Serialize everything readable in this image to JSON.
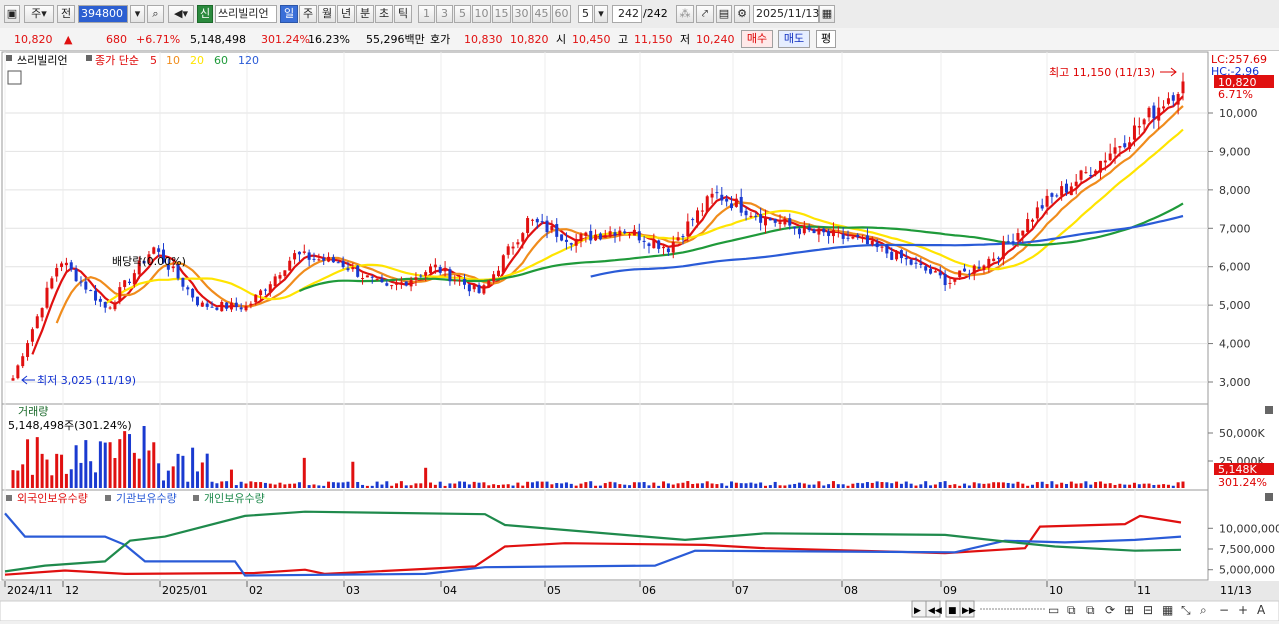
{
  "toolbar": {
    "market": "주",
    "prev": "전",
    "code": "394800",
    "credit_badge": "신",
    "name": "쓰리빌리언",
    "periods": [
      "일",
      "주",
      "월",
      "년",
      "분",
      "초",
      "틱"
    ],
    "active_period": "일",
    "intervals": [
      "1",
      "3",
      "5",
      "10",
      "15",
      "30",
      "45",
      "60"
    ],
    "interval_value": "5",
    "count": "242",
    "count_total": "/242",
    "date": "2025/11/13"
  },
  "info": {
    "price": "10,820",
    "arrow": "▲",
    "change": "680",
    "change_pct": "+6.71%",
    "volume": "5,148,498",
    "volume_ratio": "301.24%",
    "turnover_pct": "16.23%",
    "amount": "55,296백만",
    "ask_label": "호가",
    "ask1": "10,830",
    "ask2": "10,820",
    "open_label": "시",
    "open": "10,450",
    "high_label": "고",
    "high": "11,150",
    "low_label": "저",
    "low": "10,240",
    "buy_label": "매수",
    "sell_label": "매도",
    "eval_label": "평"
  },
  "price_panel": {
    "legend_name": "쓰리빌리언",
    "legend_ma_label": "종가 단순",
    "ma_periods": [
      "5",
      "10",
      "20",
      "60",
      "120"
    ],
    "ma_colors": [
      "#e01010",
      "#f08c1c",
      "#ffe400",
      "#1f9a3a",
      "#2a5bd7"
    ],
    "lc_label": "LC:257.69",
    "hc_label": "HC:-2.96",
    "last_price_tag": "10,820",
    "last_pct_tag": "6.71%",
    "high_annot": "최고 11,150 (11/13)",
    "low_annot": "최저 3,025 (11/19)",
    "dividend_annot": "배당락(0.00%)",
    "y_ticks": [
      "10,000",
      "9,000",
      "8,000",
      "7,000",
      "6,000",
      "5,000",
      "4,000",
      "3,000"
    ]
  },
  "volume_panel": {
    "title": "거래량",
    "value_label": "5,148,498주(301.24%)",
    "y_ticks": [
      "50,000K",
      "25,000K"
    ],
    "last_tag": "5,148K",
    "last_pct": "301.24%"
  },
  "holding_panel": {
    "legend": [
      "외국인보유수량",
      "기관보유수량",
      "개인보유수량"
    ],
    "legend_colors": [
      "#e01010",
      "#2a5bd7",
      "#1f8a4c"
    ],
    "y_ticks": [
      "10,000,000",
      "7,500,000",
      "5,000,000"
    ]
  },
  "x_axis": {
    "labels": [
      "2024/11",
      "12",
      "2025/01",
      "02",
      "03",
      "04",
      "05",
      "06",
      "07",
      "08",
      "09",
      "10",
      "11"
    ],
    "right_label": "11/13"
  },
  "chart_data": {
    "type": "candlestick",
    "symbol": "394800",
    "name": "쓰리빌리언",
    "period": "daily",
    "high": {
      "value": 11150,
      "date": "11/13"
    },
    "low": {
      "value": 3025,
      "date": "11/19"
    },
    "last_close": 10820,
    "ma_periods": [
      5,
      10,
      20,
      60,
      120
    ],
    "approx_close_path": [
      {
        "x": "2024/11",
        "y": 3100
      },
      {
        "x": "12",
        "y": 6200
      },
      {
        "x": "12 mid",
        "y": 4900
      },
      {
        "x": "12 late",
        "y": 6500
      },
      {
        "x": "2025/01",
        "y": 5000
      },
      {
        "x": "01 mid",
        "y": 4950
      },
      {
        "x": "02",
        "y": 6300
      },
      {
        "x": "02 mid",
        "y": 6100
      },
      {
        "x": "03",
        "y": 5400
      },
      {
        "x": "03 mid",
        "y": 6000
      },
      {
        "x": "04",
        "y": 5300
      },
      {
        "x": "04 mid",
        "y": 7200
      },
      {
        "x": "05",
        "y": 6700
      },
      {
        "x": "05 mid",
        "y": 7000
      },
      {
        "x": "06",
        "y": 6500
      },
      {
        "x": "06 mid",
        "y": 7900
      },
      {
        "x": "07",
        "y": 7300
      },
      {
        "x": "07 mid",
        "y": 6900
      },
      {
        "x": "08",
        "y": 6700
      },
      {
        "x": "08 mid",
        "y": 6200
      },
      {
        "x": "09",
        "y": 5600
      },
      {
        "x": "09 mid",
        "y": 6300
      },
      {
        "x": "10",
        "y": 7600
      },
      {
        "x": "10 mid",
        "y": 8500
      },
      {
        "x": "11",
        "y": 9600
      },
      {
        "x": "11/13",
        "y": 10820
      }
    ],
    "volume_unit": "shares",
    "last_volume": 5148498,
    "holdings_series": [
      {
        "name": "외국인보유수량",
        "approx_range": [
          4200000,
          11000000
        ]
      },
      {
        "name": "기관보유수량",
        "approx_range": [
          4000000,
          9000000
        ]
      },
      {
        "name": "개인보유수량",
        "approx_range": [
          4500000,
          12000000
        ]
      }
    ]
  }
}
